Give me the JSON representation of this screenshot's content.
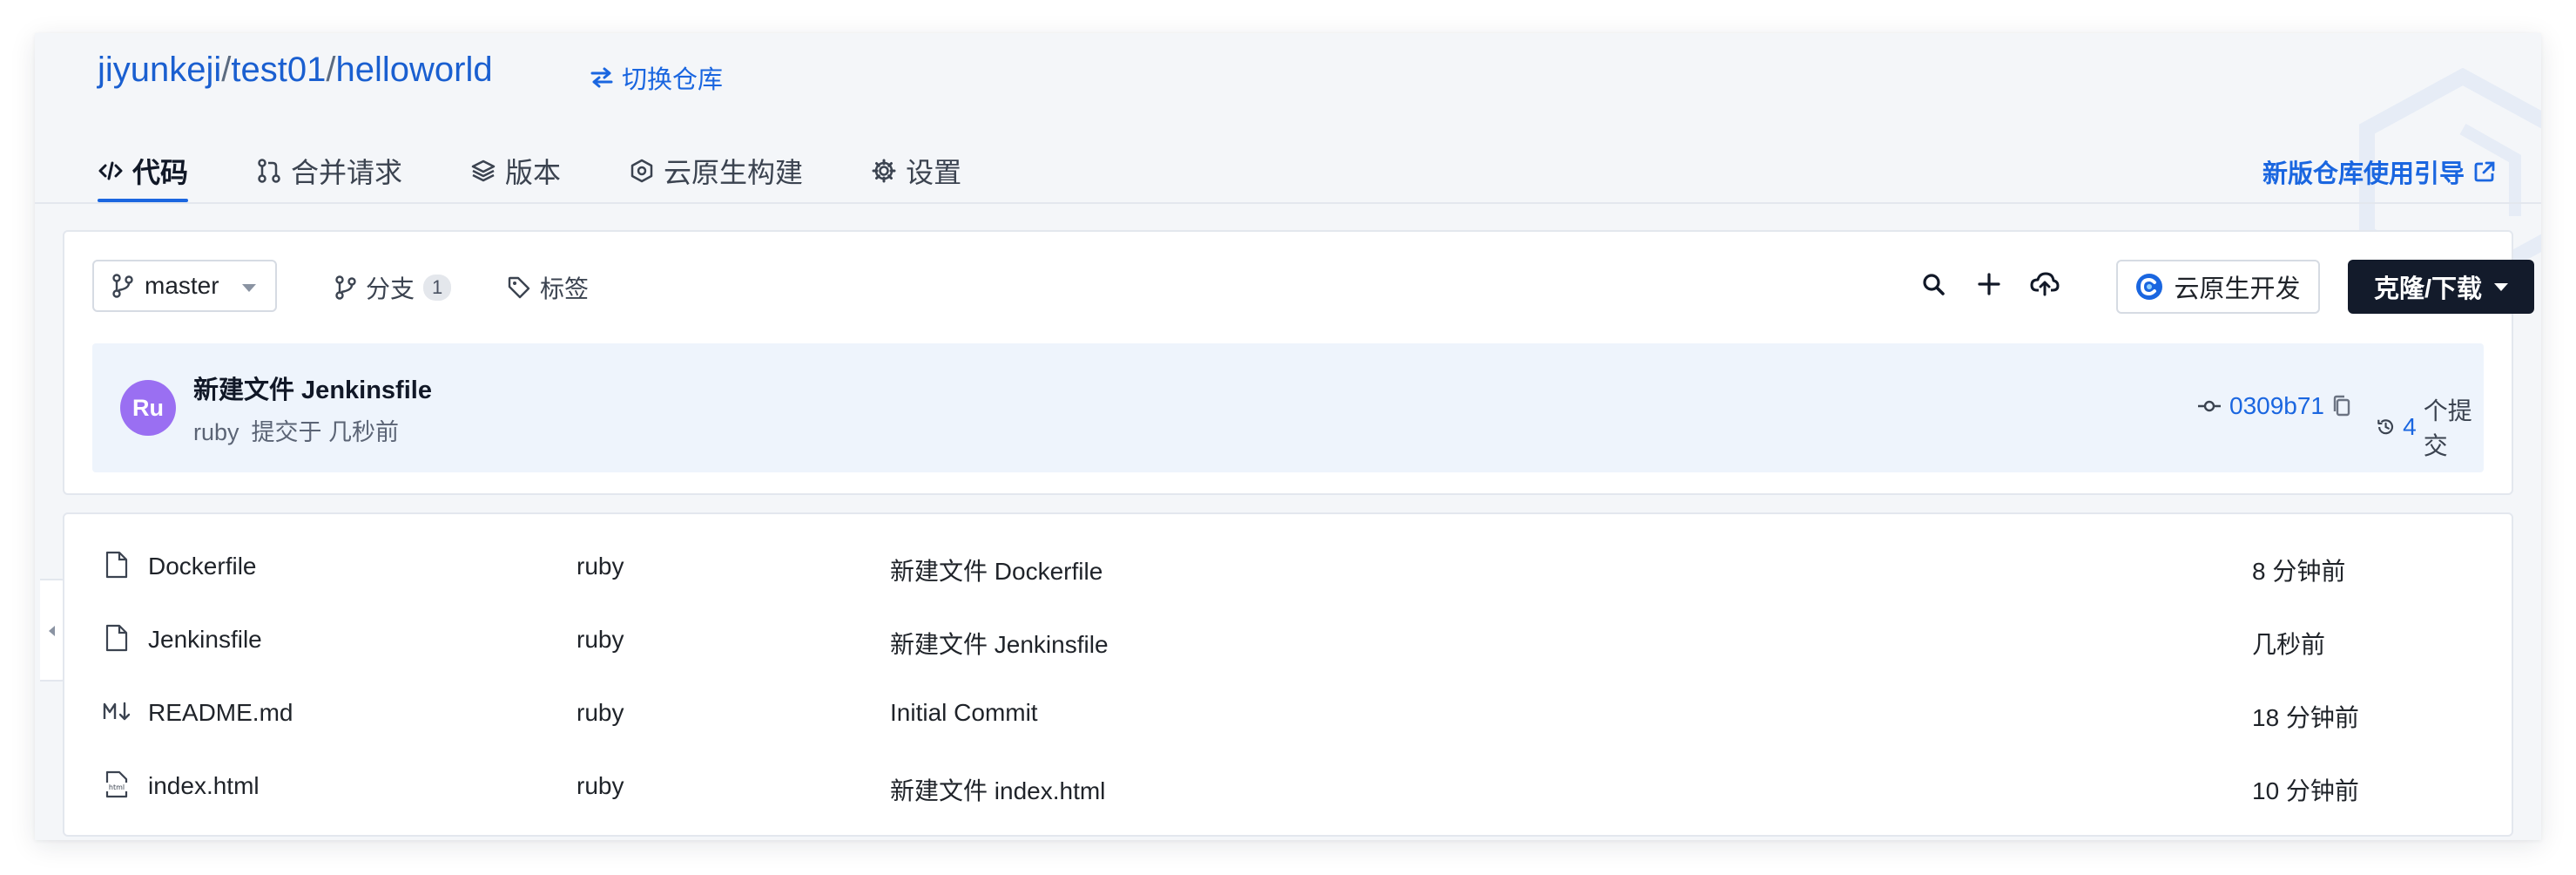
{
  "header": {
    "repo_owner": "jiyunkeji",
    "repo_group": "test01",
    "repo_name": "helloworld",
    "separator": "/",
    "switch_repo_label": "切换仓库",
    "guide_label": "新版仓库使用引导"
  },
  "tabs": [
    {
      "label": "代码",
      "icon": "code-icon",
      "active": true
    },
    {
      "label": "合并请求",
      "icon": "pull-request-icon",
      "active": false
    },
    {
      "label": "版本",
      "icon": "layers-icon",
      "active": false
    },
    {
      "label": "云原生构建",
      "icon": "build-icon",
      "active": false
    },
    {
      "label": "设置",
      "icon": "gear-icon",
      "active": false
    }
  ],
  "toolbar": {
    "branch": "master",
    "branches_label": "分支",
    "branches_count": "1",
    "tags_label": "标签",
    "cloud_dev_label": "云原生开发",
    "clone_label": "克隆/下载"
  },
  "commit": {
    "avatar_initials": "Ru",
    "title": "新建文件 Jenkinsfile",
    "author": "ruby",
    "time": "提交于 几秒前",
    "hash": "0309b71",
    "count": "4",
    "count_suffix": "个提交"
  },
  "files": [
    {
      "icon": "file-icon",
      "name": "Dockerfile",
      "author": "ruby",
      "message": "新建文件 Dockerfile",
      "time": "8 分钟前"
    },
    {
      "icon": "file-icon",
      "name": "Jenkinsfile",
      "author": "ruby",
      "message": "新建文件 Jenkinsfile",
      "time": "几秒前"
    },
    {
      "icon": "markdown-icon",
      "name": "README.md",
      "author": "ruby",
      "message": "Initial Commit",
      "time": "18 分钟前"
    },
    {
      "icon": "html-file-icon",
      "name": "index.html",
      "author": "ruby",
      "message": "新建文件 index.html",
      "time": "10 分钟前"
    }
  ],
  "colors": {
    "accent": "#1a66e0",
    "avatar": "#9a6ff2",
    "clone_button": "#131b2b"
  }
}
